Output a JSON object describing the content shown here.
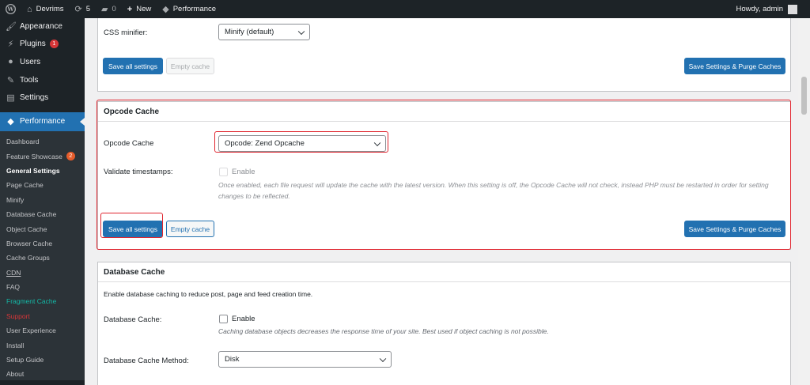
{
  "adminbar": {
    "site_name": "Devrims",
    "updates_count": "5",
    "comments_count": "0",
    "new_label": "New",
    "performance_label": "Performance",
    "howdy": "Howdy, admin"
  },
  "sidebar": {
    "top_items": [
      {
        "label": "Appearance",
        "icon": "paintbrush-icon"
      },
      {
        "label": "Plugins",
        "icon": "plug-icon",
        "badge": "1"
      },
      {
        "label": "Users",
        "icon": "users-icon"
      },
      {
        "label": "Tools",
        "icon": "wrench-icon"
      },
      {
        "label": "Settings",
        "icon": "settings-icon"
      }
    ],
    "current": {
      "label": "Performance",
      "icon": "performance-icon"
    },
    "submenu": [
      {
        "label": "Dashboard"
      },
      {
        "label": "Feature Showcase",
        "badge": "2"
      },
      {
        "label": "General Settings"
      },
      {
        "label": "Page Cache"
      },
      {
        "label": "Minify"
      },
      {
        "label": "Database Cache"
      },
      {
        "label": "Object Cache"
      },
      {
        "label": "Browser Cache"
      },
      {
        "label": "Cache Groups"
      },
      {
        "label": "CDN"
      },
      {
        "label": "FAQ"
      },
      {
        "label": "Fragment Cache"
      },
      {
        "label": "Support"
      },
      {
        "label": "User Experience"
      },
      {
        "label": "Install"
      },
      {
        "label": "Setup Guide"
      },
      {
        "label": "About"
      }
    ]
  },
  "minify_box": {
    "css_minifier_label": "CSS minifier:",
    "css_minifier_value": "Minify (default)",
    "save_all": "Save all settings",
    "empty_cache": "Empty cache",
    "save_purge": "Save Settings & Purge Caches"
  },
  "opcode_box": {
    "title": "Opcode Cache",
    "opcode_label": "Opcode Cache",
    "opcode_value": "Opcode: Zend Opcache",
    "validate_label": "Validate timestamps:",
    "enable_label": "Enable",
    "validate_desc": "Once enabled, each file request will update the cache with the latest version. When this setting is off, the Opcode Cache will not check, instead PHP must be restarted in order for setting changes to be reflected.",
    "save_all": "Save all settings",
    "empty_cache": "Empty cache",
    "save_purge": "Save Settings & Purge Caches"
  },
  "database_box": {
    "title": "Database Cache",
    "intro": "Enable database caching to reduce post, page and feed creation time.",
    "db_cache_label": "Database Cache:",
    "enable_label": "Enable",
    "db_cache_desc": "Caching database objects decreases the response time of your site. Best used if object caching is not possible.",
    "method_label": "Database Cache Method:",
    "method_value": "Disk"
  },
  "colors": {
    "accent": "#2271b1",
    "highlight": "#e0262f",
    "sidebar_bg": "#1d2327"
  }
}
